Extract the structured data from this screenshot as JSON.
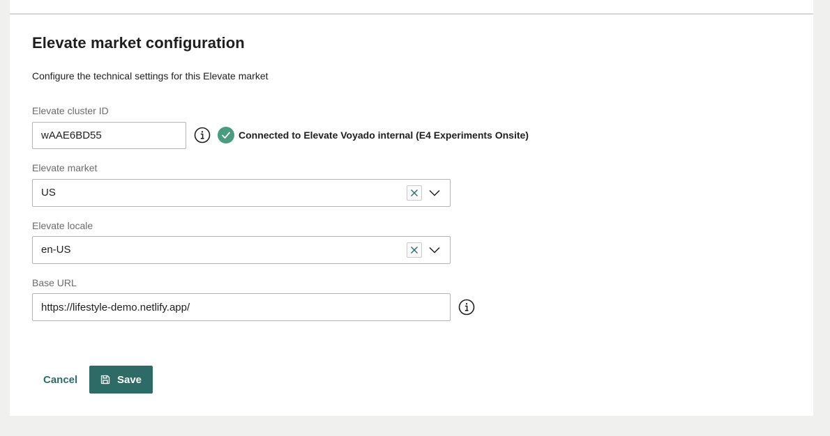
{
  "page": {
    "title": "Elevate market configuration",
    "subtitle": "Configure the technical settings for this Elevate market"
  },
  "fields": {
    "cluster_id": {
      "label": "Elevate cluster ID",
      "value": "wAAE6BD55",
      "status_text": "Connected to Elevate Voyado internal (E4 Experiments Onsite)"
    },
    "market": {
      "label": "Elevate market",
      "value": "US"
    },
    "locale": {
      "label": "Elevate locale",
      "value": "en-US"
    },
    "base_url": {
      "label": "Base URL",
      "value": "https://lifestyle-demo.netlify.app/"
    }
  },
  "actions": {
    "cancel_label": "Cancel",
    "save_label": "Save"
  },
  "icons": {
    "info": "info-icon",
    "status": "check-circle-icon",
    "clear": "close-icon",
    "dropdown": "chevron-down-icon",
    "save": "floppy-disk-icon"
  },
  "colors": {
    "accent": "#2e6b67",
    "success": "#4a9b7f",
    "label": "#6b6b6b",
    "text": "#1e1e1e",
    "page_bg": "#f0f0ee"
  }
}
